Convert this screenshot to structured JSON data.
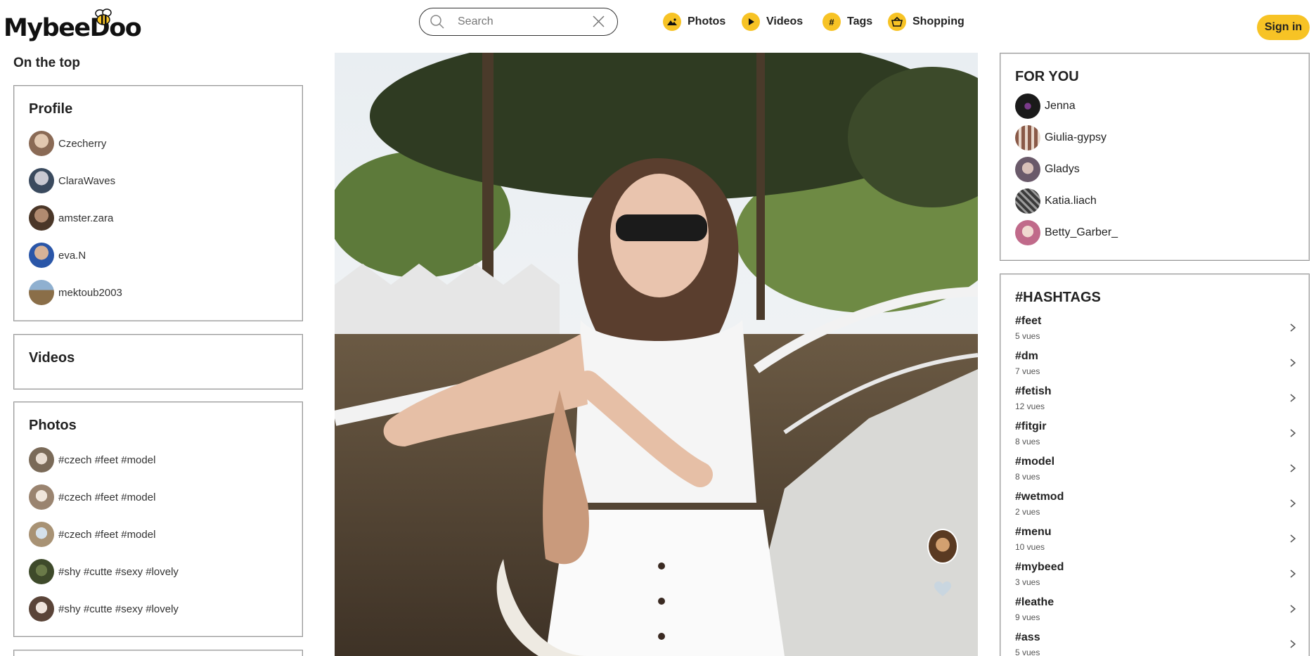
{
  "header": {
    "logo_text": "MybeeDoo",
    "search_placeholder": "Search",
    "nav": [
      {
        "label": "Photos",
        "icon": "photos-icon"
      },
      {
        "label": "Videos",
        "icon": "play-icon"
      },
      {
        "label": "Tags",
        "icon": "hash-icon"
      },
      {
        "label": "Shopping",
        "icon": "basket-icon"
      }
    ],
    "signin_label": "Sign in"
  },
  "left": {
    "heading": "On the top",
    "profile": {
      "title": "Profile",
      "items": [
        {
          "label": "Czecherry",
          "color": "#8a6a55"
        },
        {
          "label": "ClaraWaves",
          "color": "#3a4a5e"
        },
        {
          "label": "amster.zara",
          "color": "#4a3628"
        },
        {
          "label": "eva.N",
          "color": "#2a56a8"
        },
        {
          "label": "mektoub2003",
          "color": "#8a6e48"
        }
      ]
    },
    "videos": {
      "title": "Videos"
    },
    "photos": {
      "title": "Photos",
      "items": [
        {
          "label": "#czech #feet #model",
          "color": "#7a6a58"
        },
        {
          "label": "#czech #feet #model",
          "color": "#9a8470"
        },
        {
          "label": "#czech #feet #model",
          "color": "#a89274"
        },
        {
          "label": "#shy #cutte #sexy #lovely",
          "color": "#3e4a2a"
        },
        {
          "label": "#shy #cutte #sexy #lovely",
          "color": "#5a4438"
        }
      ]
    }
  },
  "right": {
    "for_you": {
      "title": "FOR YOU",
      "items": [
        {
          "label": "Jenna",
          "color": "#1a1a1a"
        },
        {
          "label": "Giulia-gypsy",
          "color": "#8a5a48"
        },
        {
          "label": "Gladys",
          "color": "#6a5a6a"
        },
        {
          "label": "Katia.liach",
          "color": "#3a3a3a"
        },
        {
          "label": "Betty_Garber_",
          "color": "#c8a8a8"
        }
      ]
    },
    "hashtags": {
      "title": "#HASHTAGS",
      "items": [
        {
          "tag": "#feet",
          "views": "5 vues"
        },
        {
          "tag": "#dm",
          "views": "7 vues"
        },
        {
          "tag": "#fetish",
          "views": "12 vues"
        },
        {
          "tag": "#fitgir",
          "views": "8 vues"
        },
        {
          "tag": "#model",
          "views": "8 vues"
        },
        {
          "tag": "#wetmod",
          "views": "2 vues"
        },
        {
          "tag": "#menu",
          "views": "10 vues"
        },
        {
          "tag": "#mybeed",
          "views": "3 vues"
        },
        {
          "tag": "#leathe",
          "views": "9 vues"
        },
        {
          "tag": "#ass",
          "views": "5 vues"
        }
      ]
    }
  },
  "colors": {
    "accent": "#f7c325"
  }
}
